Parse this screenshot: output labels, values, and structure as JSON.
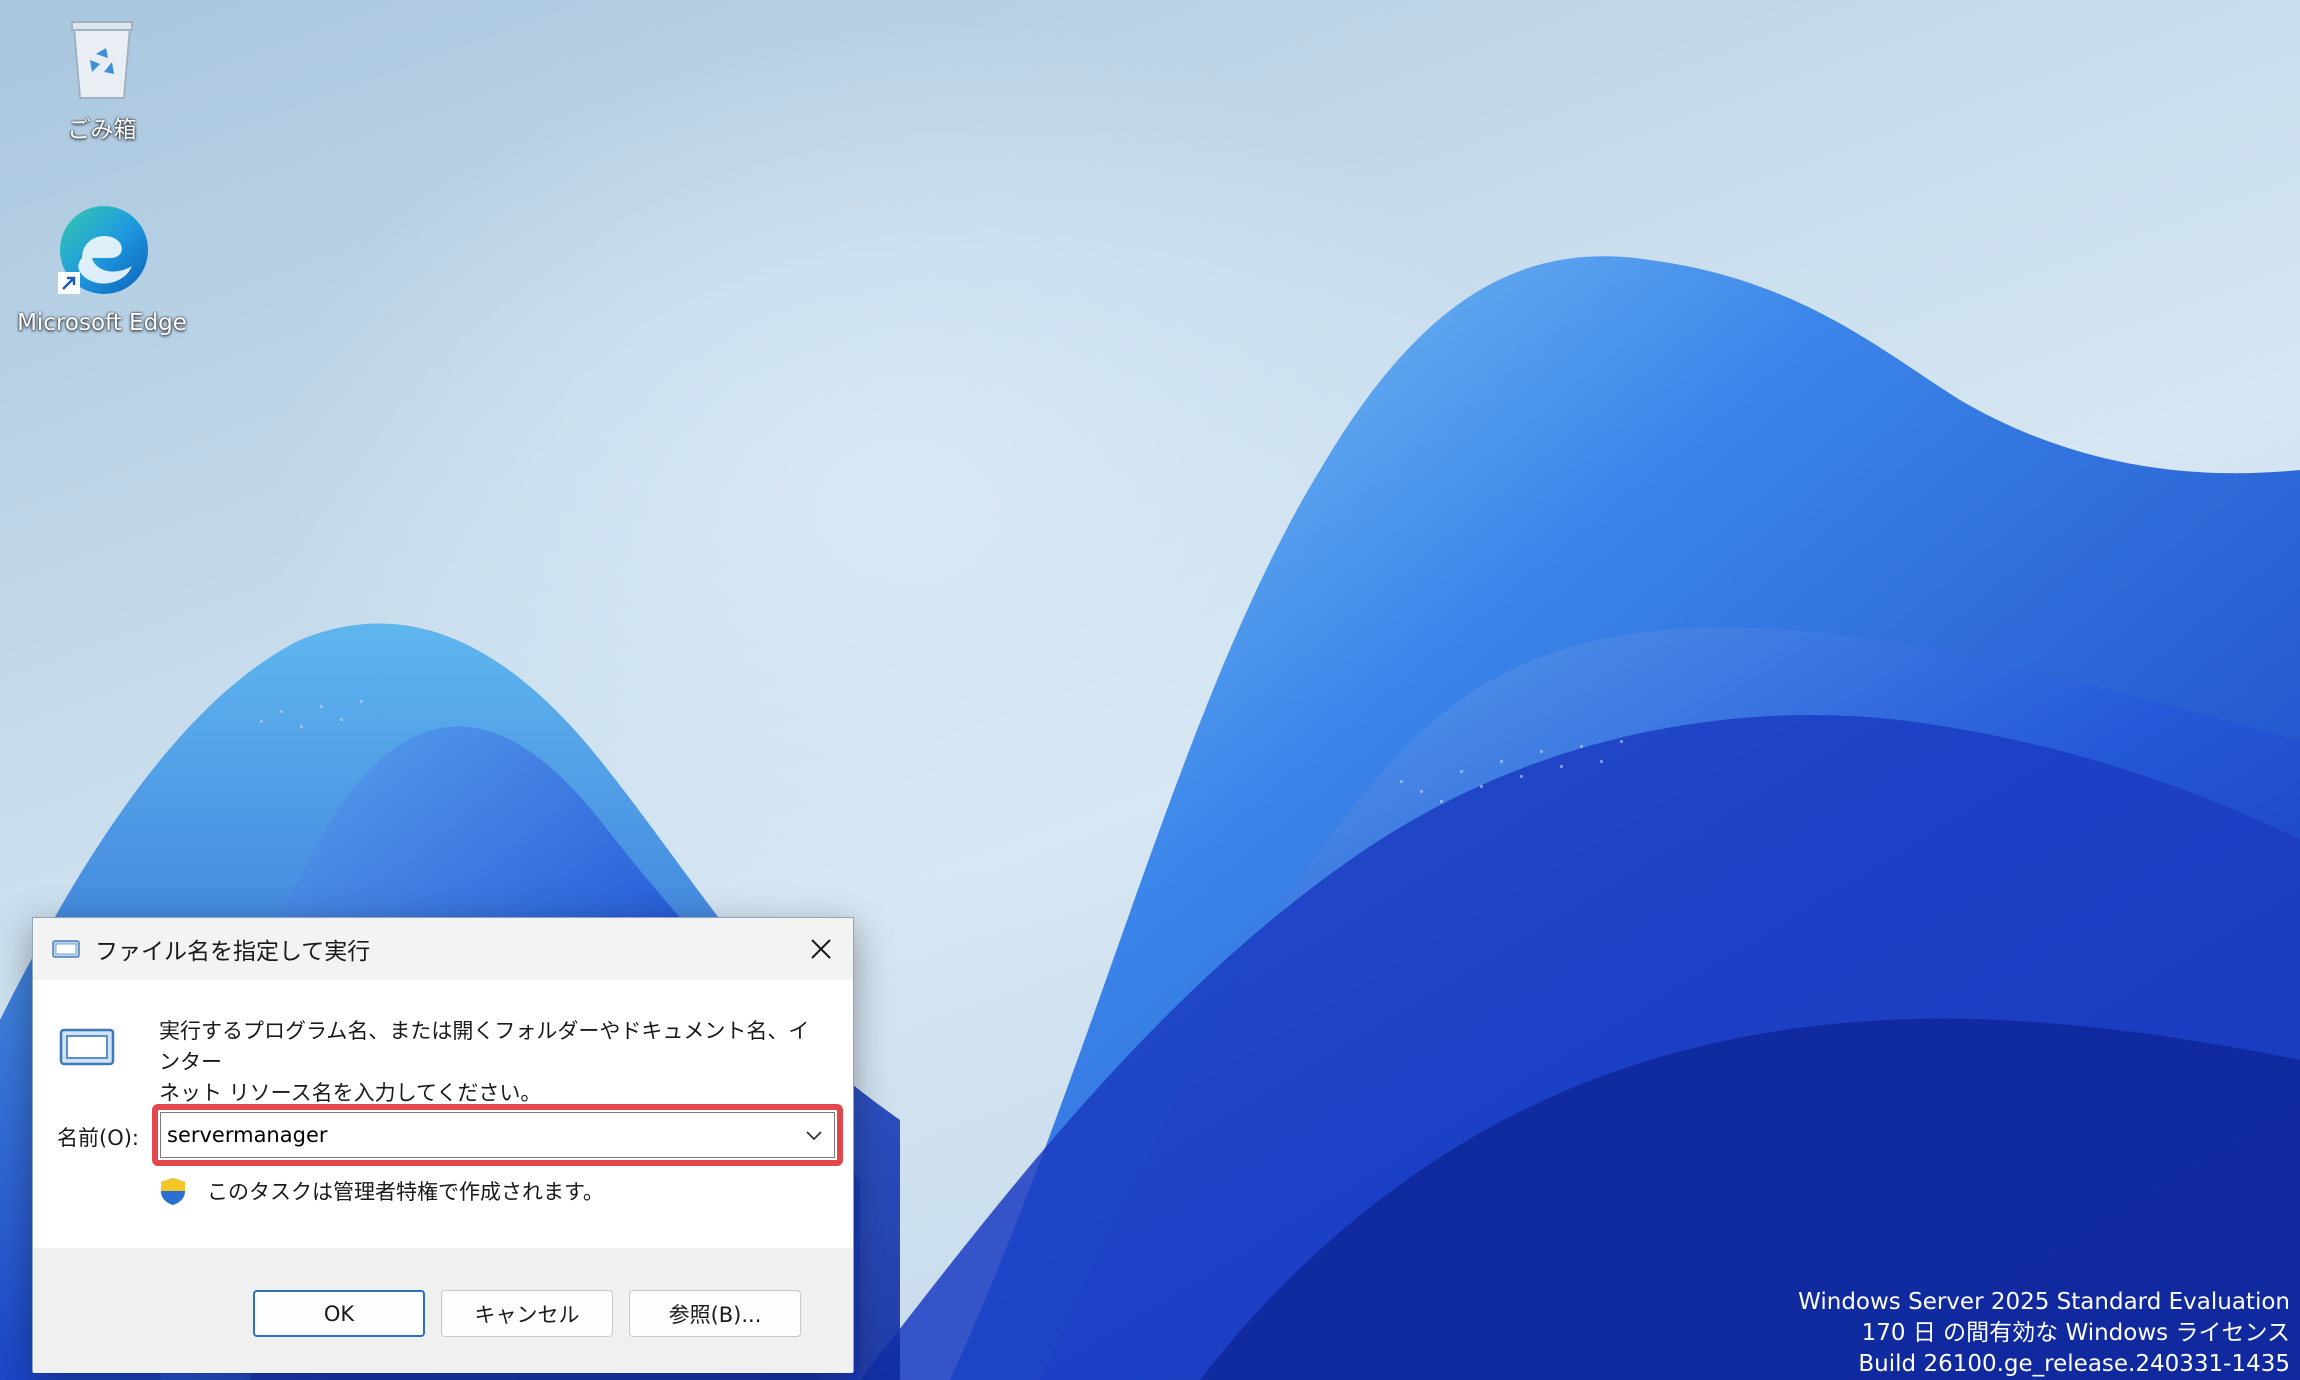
{
  "desktop": {
    "icons": [
      {
        "label": "ごみ箱",
        "icon": "recycle-bin-icon"
      },
      {
        "label": "Microsoft Edge",
        "icon": "edge-icon"
      }
    ]
  },
  "watermark": {
    "line1": "Windows Server 2025 Standard Evaluation",
    "line2": "170 日 の間有効な Windows ライセンス",
    "line3": "Build 26100.ge_release.240331-1435"
  },
  "run_dialog": {
    "title": "ファイル名を指定して実行",
    "description_line1": "実行するプログラム名、または開くフォルダーやドキュメント名、インター",
    "description_line2": "ネット リソース名を入力してください。",
    "name_label": "名前(O):",
    "name_value": "servermanager",
    "admin_note": "このタスクは管理者特権で作成されます。",
    "buttons": {
      "ok": "OK",
      "cancel": "キャンセル",
      "browse": "参照(B)..."
    },
    "highlight_color": "#e1474c"
  },
  "colors": {
    "wave_dark": "#1a3fc4",
    "wave_mid": "#2f6fe6",
    "wave_light": "#6fb4f0",
    "accent": "#2f6fc0"
  }
}
